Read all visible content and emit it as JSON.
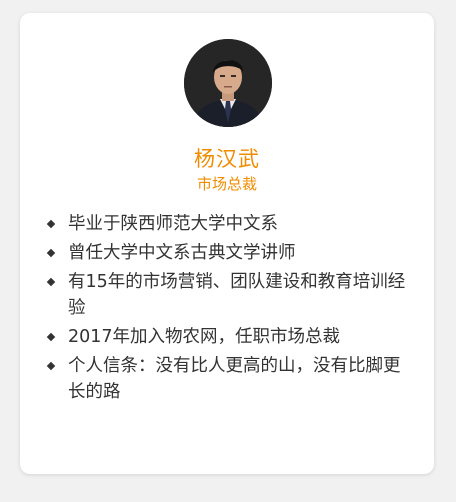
{
  "profile": {
    "name": "杨汉武",
    "title": "市场总裁",
    "colors": {
      "accent": "#f08c00",
      "text": "#333333",
      "card": "#ffffff",
      "background": "#f1f1f1"
    },
    "avatar": "portrait-photo",
    "bio": [
      "毕业于陕西师范大学中文系",
      "曾任大学中文系古典文学讲师",
      "有15年的市场营销、团队建设和教育培训经验",
      "2017年加入物农网，任职市场总裁",
      "个人信条：没有比人更高的山，没有比脚更长的路"
    ]
  }
}
